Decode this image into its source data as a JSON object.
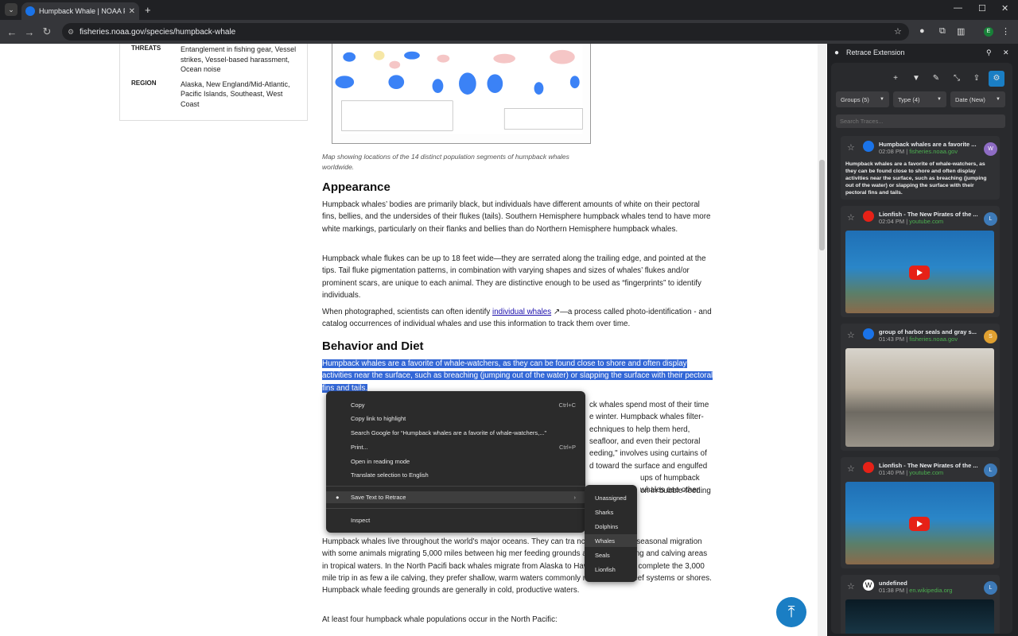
{
  "browser": {
    "tab_title": "Humpback Whale | NOAA Fishe",
    "url": "fisheries.noaa.gov/species/humpback-whale",
    "profile_initial": "E"
  },
  "info": {
    "threats_label": "THREATS",
    "threats_value": "Entanglement in fishing gear, Vessel strikes, Vessel-based harassment, Ocean noise",
    "region_label": "REGION",
    "region_value": "Alaska, New England/Mid-Atlantic, Pacific Islands, Southeast, West Coast"
  },
  "map_caption": "Map showing locations of the 14 distinct population segments of humpback whales worldwide.",
  "appearance": {
    "heading": "Appearance",
    "p1": "Humpback whales’ bodies are primarily black, but individuals have different amounts of white on their pectoral fins, bellies, and the undersides of their flukes (tails). Southern Hemisphere humpback whales tend to have more white markings, particularly on their flanks and bellies than do Northern Hemisphere humpback whales.",
    "p2": "Humpback whale flukes can be up to 18 feet wide—they are serrated along the trailing edge, and pointed at the tips. Tail fluke pigmentation patterns, in combination with varying shapes and sizes of whales’ flukes and/or prominent scars, are unique to each animal. They are distinctive enough to be used as “fingerprints” to identify individuals.",
    "p3_before": "When photographed, scientists can often identify ",
    "p3_link": "individual whales",
    "p3_after": "—a process called photo-identification - and catalog occurrences of individual whales and use this information to track them over time."
  },
  "behavior": {
    "heading": "Behavior and Diet",
    "highlight": "Humpback whales are a favorite of whale-watchers, as they can be found close to shore and often display activities near the surface, such as breaching (jumping out of the water) or slapping the surface with their pectoral fins and tails.",
    "p2_lines": [
      "ck whales spend most of their time",
      "e winter. Humpback whales filter-",
      "echniques to help them herd,",
      "seafloor, and even their pectoral",
      "eeding,\" involves using curtains of",
      "d toward the surface and engulfed",
      "ups of humpback whales use other",
      "on in bubble-feeding"
    ]
  },
  "where": {
    "p1": "Humpback whales live throughout the world's major oceans. They can tra                    nces during their seasonal migration with some animals migrating 5,000 miles between hig              mer feeding grounds and winter mating and calving areas in tropical waters. In the North Pacifi               back whales migrate from Alaska to Hawaiʻi—they can complete the 3,000 mile trip in as few a               ile calving, they prefer shallow, warm waters commonly near offshore reef systems or shores. Humpback whale feeding grounds are generally in cold, productive waters.",
    "p2": "At least four humpback whale populations occur in the North Pacific:"
  },
  "context_menu": {
    "copy": "Copy",
    "copy_sc": "Ctrl+C",
    "copy_link": "Copy link to highlight",
    "search": "Search Google for “Humpback whales are a favorite of whale-watchers,...”",
    "print": "Print...",
    "print_sc": "Ctrl+P",
    "reading": "Open in reading mode",
    "translate": "Translate selection to English",
    "save": "Save Text to Retrace",
    "inspect": "Inspect"
  },
  "submenu": [
    "Unassigned",
    "Sharks",
    "Dolphins",
    "Whales",
    "Seals",
    "Lionfish"
  ],
  "panel": {
    "title": "Retrace Extension",
    "groups": "Groups (5)",
    "type": "Type (4)",
    "date": "Date (New)",
    "search_placeholder": "Search Traces...",
    "cards": [
      {
        "title": "Humpback whales are a favorite ...",
        "time": "02:08 PM",
        "domain": "fisheries.noaa.gov",
        "initial": "W",
        "text": "Humpback whales are a favorite of whale-watchers, as they can be found close to shore and often display activities near the surface, such as breaching (jumping out of the water) or slapping the surface with their pectoral fins and tails."
      },
      {
        "title": "Lionfish - The New Pirates of the ...",
        "time": "02:04 PM",
        "domain": "youtube.com",
        "initial": "L"
      },
      {
        "title": "group of harbor seals and gray s...",
        "time": "01:43 PM",
        "domain": "fisheries.noaa.gov",
        "initial": "S"
      },
      {
        "title": "Lionfish - The New Pirates of the ...",
        "time": "01:40 PM",
        "domain": "youtube.com",
        "initial": "L"
      },
      {
        "title": "undefined",
        "time": "01:38 PM",
        "domain": "en.wikipedia.org",
        "initial": "L"
      }
    ]
  },
  "colors": {
    "highlight": "#3367d6",
    "accent": "#1a7ec4"
  }
}
